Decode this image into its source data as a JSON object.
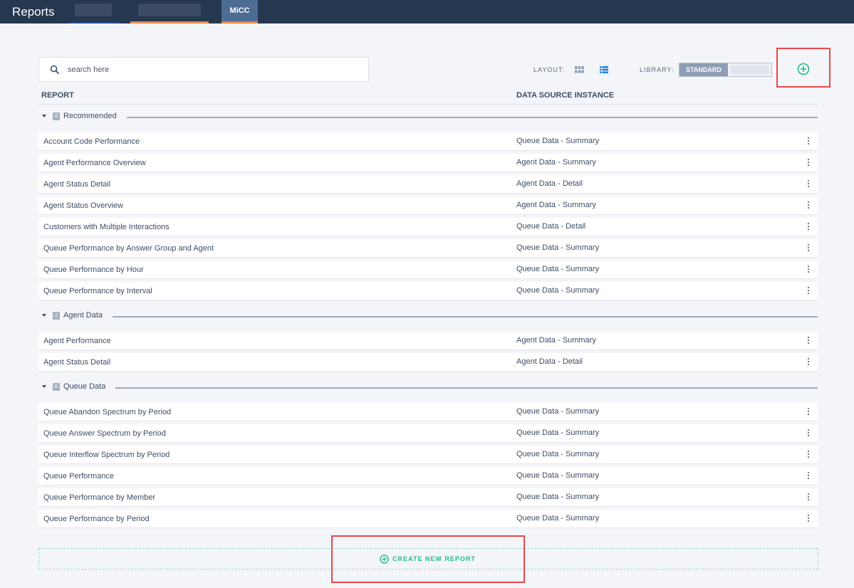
{
  "app": {
    "title": "Reports"
  },
  "tabs": [
    {
      "label": ""
    },
    {
      "label": ""
    },
    {
      "label": "MiCC"
    }
  ],
  "search": {
    "placeholder": "search here",
    "value": ""
  },
  "controls": {
    "layout_label": "LAYOUT:",
    "library_label": "LIBRARY:",
    "library_selected": "STANDARD",
    "layout_selected": "list"
  },
  "columns": {
    "report": "REPORT",
    "data_source": "DATA SOURCE INSTANCE"
  },
  "groups": [
    {
      "count": "8",
      "label": "Recommended",
      "rows": [
        {
          "name": "Account Code Performance",
          "source": "Queue Data - Summary"
        },
        {
          "name": "Agent Performance Overview",
          "source": "Agent Data - Summary"
        },
        {
          "name": "Agent Status Detail",
          "source": "Agent Data - Detail"
        },
        {
          "name": "Agent Status Overview",
          "source": "Agent Data - Summary"
        },
        {
          "name": "Customers with Multiple Interactions",
          "source": "Queue Data - Detail"
        },
        {
          "name": "Queue Performance by Answer Group and Agent",
          "source": "Queue Data - Summary"
        },
        {
          "name": "Queue Performance by Hour",
          "source": "Queue Data - Summary"
        },
        {
          "name": "Queue Performance by Interval",
          "source": "Queue Data - Summary"
        }
      ]
    },
    {
      "count": "2",
      "label": "Agent Data",
      "rows": [
        {
          "name": "Agent Performance",
          "source": "Agent Data - Summary"
        },
        {
          "name": "Agent Status Detail",
          "source": "Agent Data - Detail"
        }
      ]
    },
    {
      "count": "6",
      "label": "Queue Data",
      "rows": [
        {
          "name": "Queue Abandon Spectrum by Period",
          "source": "Queue Data - Summary"
        },
        {
          "name": "Queue Answer Spectrum by Period",
          "source": "Queue Data - Summary"
        },
        {
          "name": "Queue Interflow Spectrum by Period",
          "source": "Queue Data - Summary"
        },
        {
          "name": "Queue Performance",
          "source": "Queue Data - Summary"
        },
        {
          "name": "Queue Performance by Member",
          "source": "Queue Data - Summary"
        },
        {
          "name": "Queue Performance by Period",
          "source": "Queue Data - Summary"
        }
      ]
    }
  ],
  "create_new": {
    "label": "CREATE NEW REPORT"
  },
  "colors": {
    "topbar": "#263750",
    "accent_orange": "#f08a4b",
    "accent_green": "#27b98b",
    "highlight_red": "#e8474b"
  },
  "icons": [
    "search-icon",
    "grid-layout-icon",
    "list-layout-icon",
    "add-circle-icon",
    "more-vertical-icon",
    "caret-down-icon",
    "plus-circle-icon"
  ]
}
